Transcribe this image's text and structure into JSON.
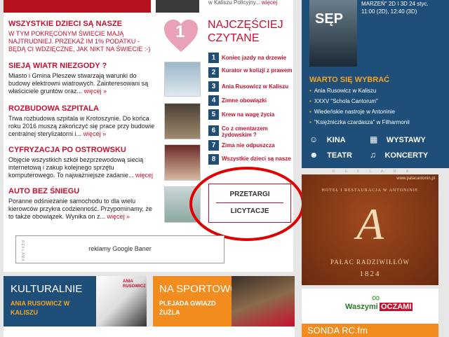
{
  "top": {
    "right_snippet": "w Kaliszu Policyjny...",
    "right_more": "więcej"
  },
  "news": [
    {
      "title": "WSZYSTKIE DZIECI SĄ NASZE",
      "text": "W TYM POKRĘCONYM ŚWIECIE MAJĄ NAJTRUDNIEJ. PRZEKAŻ IM 1% PODATKU - BĘDĄ CI WDZIĘCZNE, JAK NIKT NA ŚWIECIE :-)",
      "more": ""
    },
    {
      "title": "SIEJĄ WIATR NIEZGODY ?",
      "text": "Miasto i Gmina Pleszew stwarzają warunki do budowy elektrowni wiatrowych. Zainteresowani są właściciele gruntów oraz...",
      "more": "więcej »"
    },
    {
      "title": "ROZBUDOWA SZPITALA",
      "text": "Trwa rozbudowa szpitala w Krotoszynie. Do końca roku 2016 muszą zakończyć się prace przy budowie centralnej sterylizatorni i...",
      "more": "więcej »"
    },
    {
      "title": "CYFRYZACJA PO OSTROWSKU",
      "text": "Objęcie wszystkich szkół bezprzewodową siecią internetową i zakup kolejnego sprzętu komputerowego. To najważniejsze zadanie...",
      "more": "więcej"
    },
    {
      "title": "AUTO BEZ ŚNIEGU",
      "text": "Poranne odśnieżanie samochodu to dla wielu kierowców przykra codzienność. Przypominamy, że to także obowiązek. Wynika on z...",
      "more": "więcej »"
    }
  ],
  "heart_number": "1",
  "najczesciej": {
    "title_line1": "NAJCZĘŚCIEJ",
    "title_line2": "CZYTANE",
    "items": [
      {
        "n": "1",
        "text": "Koniec jazdy na drzewie"
      },
      {
        "n": "2",
        "text": "Kurator w kolizji z prawem"
      },
      {
        "n": "3",
        "text": "Ania Rusowicz w Kaliszu"
      },
      {
        "n": "4",
        "text": "Zimne obowiązki"
      },
      {
        "n": "5",
        "text": "Krew na wagę życia"
      },
      {
        "n": "6",
        "text": "Co z cmentarzem żydowskim ?"
      },
      {
        "n": "7",
        "text": "Zima nie odpuszcza"
      },
      {
        "n": "8",
        "text": "Wszystkie dzieci są nasze"
      }
    ]
  },
  "tenders": {
    "przetargi": "PRZETARGI",
    "licytacje": "LICYTACJE"
  },
  "google_banner": "reklamy Google Baner",
  "reklama_vertical": "REKLAMA",
  "bottom": {
    "kulturalnie": {
      "title": "KULTURALNIE",
      "sub": "ANIA RUSOWICZ W KALISZU",
      "badge": "ANIA RUSOWICZ"
    },
    "sportowo": {
      "title": "NA SPORTOWO",
      "sub": "PLEJADA GWIAZD ŻUŻLA"
    }
  },
  "sidebar": {
    "movie_info": "MARZEŃ\" 2D I 3D 24 styc. 11:00 (2D), 12:40 (3D)",
    "poster_title": "SĘP",
    "warto_title": "WARTO SIĘ WYBRAĆ",
    "warto_items": [
      "Ania Rusowicz w Kaliszu",
      "XXXV \"Schola Cantorum\"",
      "Wiedeńskie nastroje w Antoninie",
      "\"Księżniczka czardasza\" w Filharmonii"
    ],
    "cats": [
      "KINA",
      "WYSTAWY",
      "TEATR",
      "KONCERTY"
    ],
    "reklama_label": "REKLAMA",
    "ad_url": "www.palacantonin.pl",
    "ad_line1": "HOTEL I RESTAURACJA W ANTONINIE",
    "ad_letter": "A",
    "ad_name": "PAŁAC RADZIWIŁŁÓW",
    "ad_year": "1824",
    "waszymi": "Waszymi",
    "oczami": "OCZAMI",
    "sonda": "SONDA RC.fm"
  },
  "colors": {
    "accent": "#c8102e",
    "navy": "#1f4e79",
    "orange": "#f28c1e",
    "gold": "#f5a623"
  }
}
